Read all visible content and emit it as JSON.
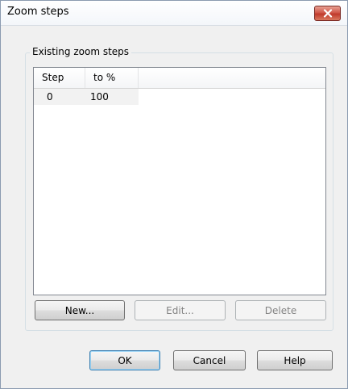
{
  "window": {
    "title": "Zoom steps"
  },
  "group": {
    "legend": "Existing zoom steps"
  },
  "list": {
    "columns": [
      "Step",
      "to %"
    ],
    "rows": [
      [
        "0",
        "100"
      ]
    ]
  },
  "list_buttons": {
    "new": "New...",
    "edit": "Edit...",
    "delete": "Delete"
  },
  "dialog_buttons": {
    "ok": "OK",
    "cancel": "Cancel",
    "help": "Help"
  },
  "icons": {
    "close": "close-icon"
  },
  "colors": {
    "close_button": "#c0392b",
    "default_button_border": "#3c7fb1"
  }
}
